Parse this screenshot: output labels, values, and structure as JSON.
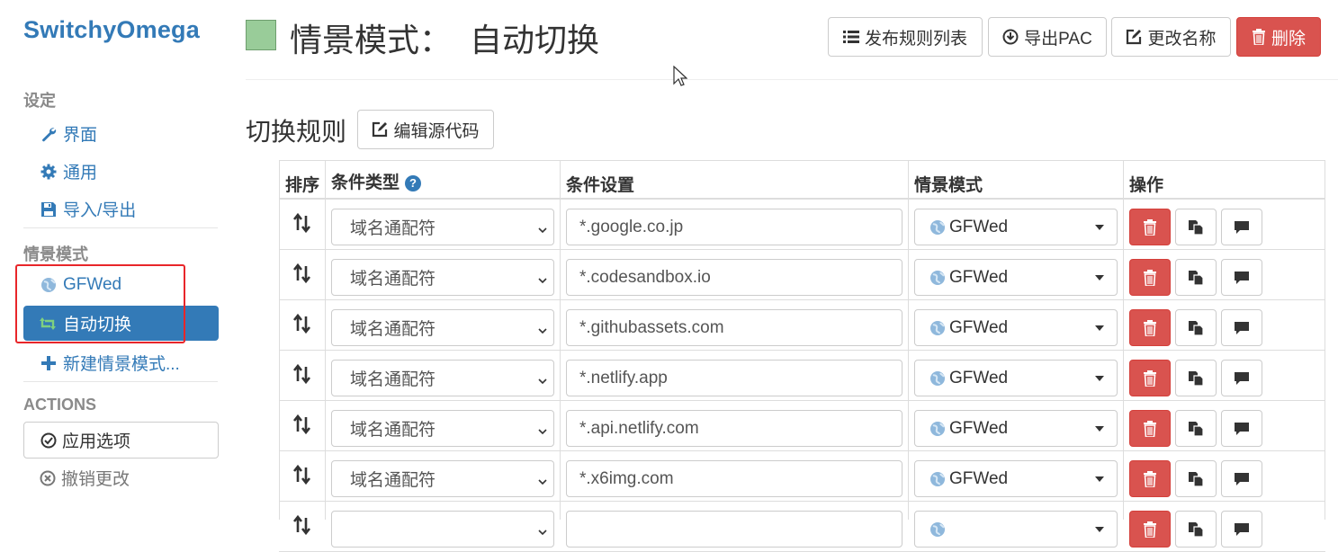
{
  "app": {
    "title": "SwitchyOmega"
  },
  "sidebar": {
    "settings_header": "设定",
    "settings_items": [
      {
        "label": "界面",
        "icon": "wrench-icon"
      },
      {
        "label": "通用",
        "icon": "gear-icon"
      },
      {
        "label": "导入/导出",
        "icon": "floppy-icon"
      }
    ],
    "profiles_header": "情景模式",
    "profiles": [
      {
        "label": "GFWed",
        "icon": "globe-icon",
        "active": false
      },
      {
        "label": "自动切换",
        "icon": "retweet-icon",
        "active": true
      }
    ],
    "new_profile_label": "新建情景模式...",
    "actions_header": "ACTIONS",
    "apply_label": "应用选项",
    "revert_label": "撤销更改"
  },
  "header": {
    "profile_color": "#99cc99",
    "title": "情景模式：  自动切换",
    "buttons": {
      "publish": "发布规则列表",
      "export_pac": "导出PAC",
      "rename": "更改名称",
      "delete": "删除"
    }
  },
  "section": {
    "title": "切换规则",
    "edit_source_label": "编辑源代码"
  },
  "table": {
    "columns": [
      "排序",
      "条件类型",
      "条件设置",
      "情景模式",
      "操作"
    ],
    "rows": [
      {
        "condition_type": "域名通配符",
        "pattern": "*.google.co.jp",
        "profile": "GFWed"
      },
      {
        "condition_type": "域名通配符",
        "pattern": "*.codesandbox.io",
        "profile": "GFWed"
      },
      {
        "condition_type": "域名通配符",
        "pattern": "*.githubassets.com",
        "profile": "GFWed"
      },
      {
        "condition_type": "域名通配符",
        "pattern": "*.netlify.app",
        "profile": "GFWed"
      },
      {
        "condition_type": "域名通配符",
        "pattern": "*.api.netlify.com",
        "profile": "GFWed"
      },
      {
        "condition_type": "域名通配符",
        "pattern": "*.x6img.com",
        "profile": "GFWed"
      },
      {
        "condition_type": "",
        "pattern": "",
        "profile": ""
      }
    ]
  },
  "colors": {
    "primary": "#337ab7",
    "danger": "#d9534f",
    "highlight_box": "#e8262a"
  }
}
